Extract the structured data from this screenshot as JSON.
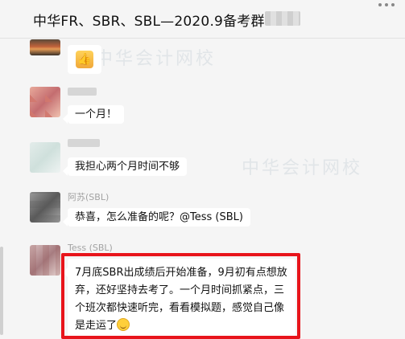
{
  "header": {
    "title": "中华FR、SBR、SBL—2020.9备考群"
  },
  "watermark": {
    "text": "中华会计网校"
  },
  "messages": [
    {
      "type": "image",
      "icon": "thumbs-up-icon"
    },
    {
      "sender": "",
      "text": "一个月！"
    },
    {
      "sender": "",
      "text": "我担心两个月时间不够"
    },
    {
      "sender": "阿苏(SBL)",
      "text": "恭喜，怎么准备的呢？@Tess (SBL)"
    },
    {
      "sender": "Tess (SBL)",
      "text": "7月底SBR出成绩后开始准备，9月初有点想放弃，还好坚持去考了。一个月时间抓紧点，三个班次都快速听完，看看模拟题，感觉自己像是走运了",
      "emoji": "smiley-icon"
    }
  ],
  "colors": {
    "highlight": "#e8141b",
    "background": "#f5f5f5"
  }
}
